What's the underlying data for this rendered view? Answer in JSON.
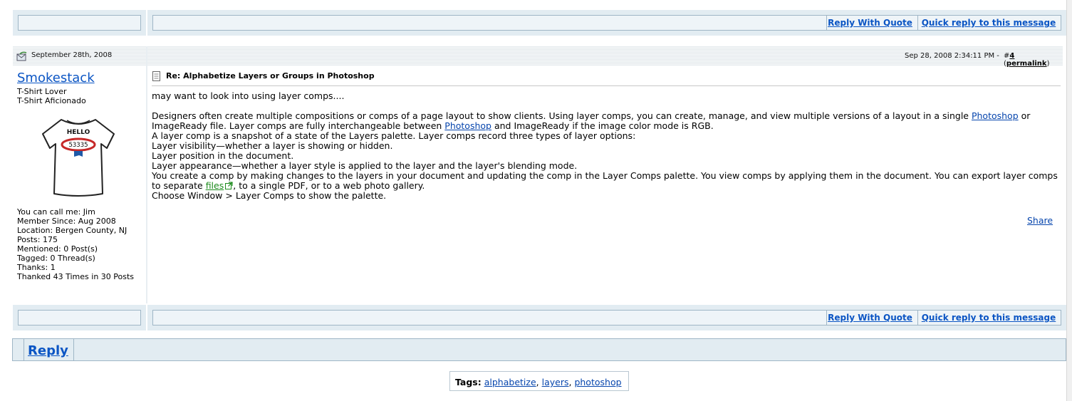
{
  "post_actions": {
    "reply_with_quote": "Reply With Quote",
    "quick_reply": "Quick reply to this message"
  },
  "post": {
    "date": "September 28th, 2008",
    "timestamp": "Sep 28, 2008 2:34:11 PM -",
    "post_number_prefix": "#",
    "post_number": "4",
    "permalink_label": "permalink",
    "title": "Re: Alphabetize Layers or Groups in Photoshop",
    "body": {
      "line1": "may want to look into using layer comps....",
      "p1_a": "Designers often create multiple compositions or comps of a page layout to show clients. Using layer comps, you can create, manage, and view multiple versions of a layout in a single ",
      "p1_link1": "Photoshop",
      "p1_b": " or ImageReady file. Layer comps are fully interchangeable between ",
      "p1_link2": "Photoshop",
      "p1_c": " and ImageReady if the image color mode is RGB.",
      "line_snapshot": "A layer comp is a snapshot of a state of the Layers palette. Layer comps record three types of layer options:",
      "line_visibility": "Layer visibility—whether a layer is showing or hidden.",
      "line_position": "Layer position in the document.",
      "line_appearance": "Layer appearance—whether a layer style is applied to the layer and the layer's blending mode.",
      "p2_a": "You create a comp by making changes to the layers in your document and updating the comp in the Layer Comps palette. You view comps by applying them in the document. You can export layer comps to separate ",
      "p2_link": "files",
      "p2_b": ", to a single PDF, or to a web photo gallery.",
      "line_choose": "Choose Window > Layer Comps to show the palette."
    },
    "share_label": "Share"
  },
  "user": {
    "name": "Smokestack",
    "title1": "T-Shirt Lover",
    "title2": "T-Shirt Aficionado",
    "avatar_text_hello": "HELLO",
    "avatar_text_number": "53335",
    "info": [
      "You can call me: Jim",
      "Member Since: Aug 2008",
      "Location: Bergen County, NJ",
      "Posts: 175",
      "Mentioned: 0 Post(s)",
      "Tagged: 0 Thread(s)",
      "Thanks: 1",
      "Thanked 43 Times in 30 Posts"
    ]
  },
  "reply_bar": {
    "reply_label": "Reply"
  },
  "tags": {
    "label": "Tags",
    "separator": ":",
    "items": [
      "alphabetize",
      "layers",
      "photoshop"
    ],
    "comma": ","
  }
}
